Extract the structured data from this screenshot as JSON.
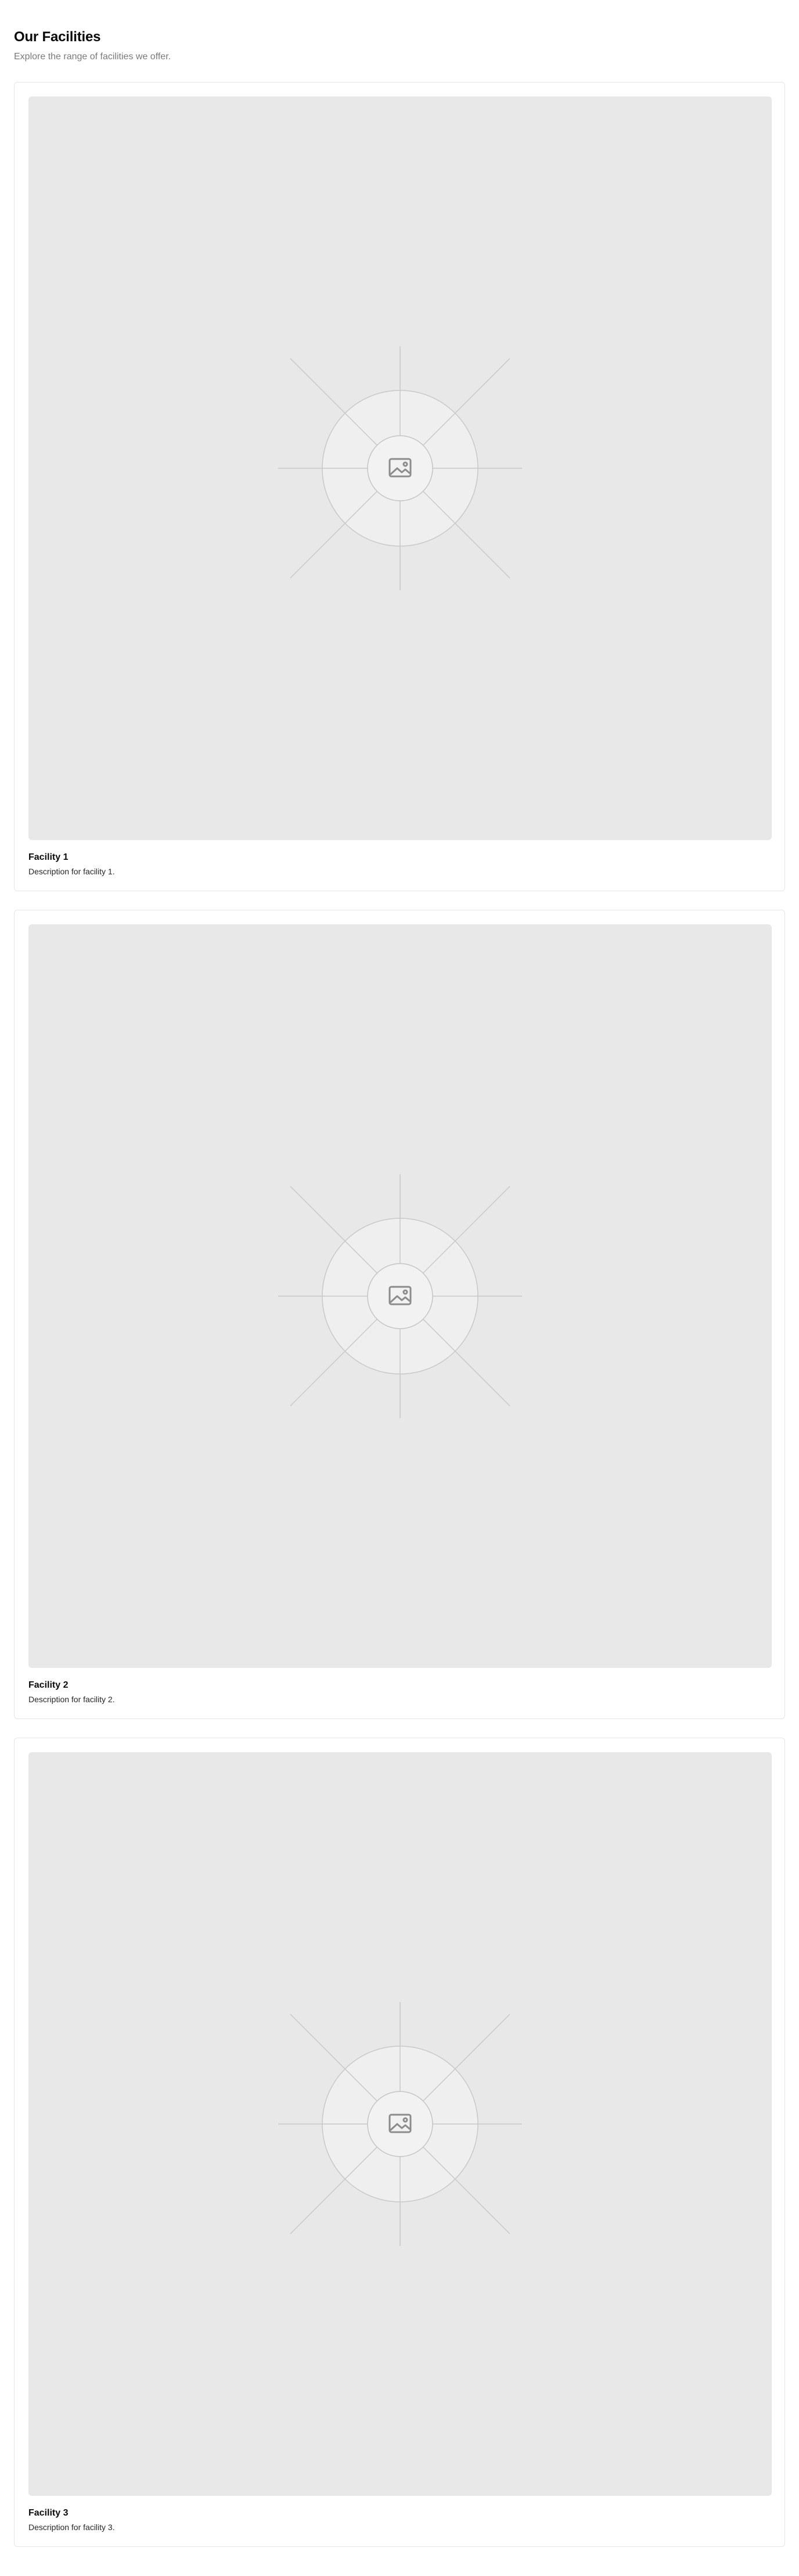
{
  "header": {
    "title": "Our Facilities",
    "subtitle": "Explore the range of facilities we offer."
  },
  "facilities": [
    {
      "title": "Facility 1",
      "description": "Description for facility 1.",
      "image_icon": "image-placeholder-icon"
    },
    {
      "title": "Facility 2",
      "description": "Description for facility 2.",
      "image_icon": "image-placeholder-icon"
    },
    {
      "title": "Facility 3",
      "description": "Description for facility 3.",
      "image_icon": "image-placeholder-icon"
    }
  ],
  "colors": {
    "image_background": "#e8e8e8",
    "card_border": "#e5e5e5",
    "subtitle_text": "#7a7a7a",
    "title_text": "#0a0a0a"
  }
}
